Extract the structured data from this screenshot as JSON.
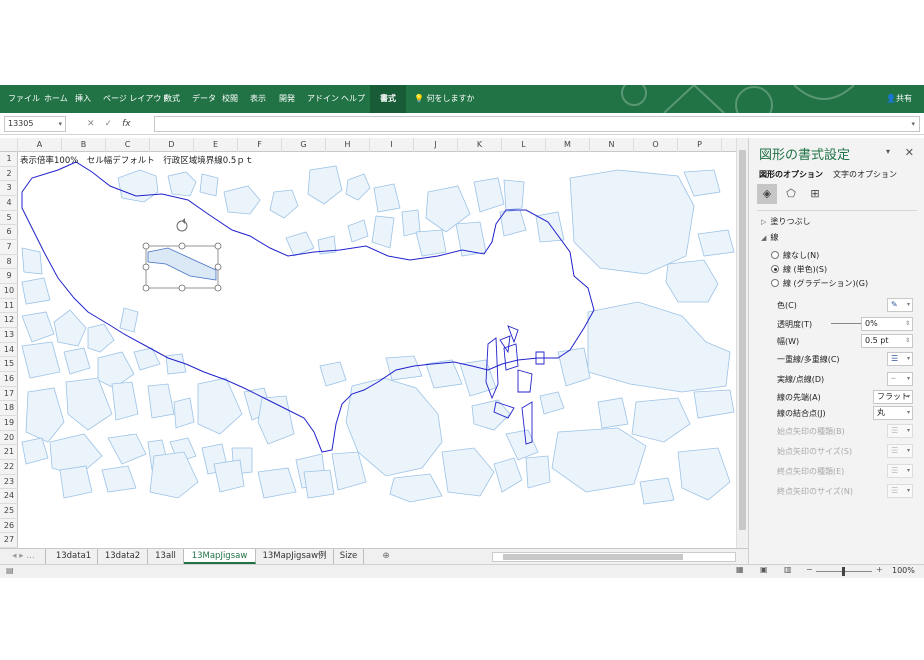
{
  "ribbon": {
    "tabs": [
      "ファイル",
      "ホーム",
      "挿入",
      "ページ レイアウト",
      "数式",
      "データ",
      "校閲",
      "表示",
      "開発",
      "アドイン",
      "ヘルプ",
      "書式"
    ],
    "active_tab": "書式",
    "tell_me": "何をしますか",
    "share": "共有"
  },
  "formula_bar": {
    "name_box": "13305",
    "cancel": "✕",
    "enter": "✓",
    "fx": "fx",
    "formula": ""
  },
  "columns": [
    "A",
    "B",
    "C",
    "D",
    "E",
    "F",
    "G",
    "H",
    "I",
    "J",
    "K",
    "L",
    "M",
    "N",
    "O",
    "P"
  ],
  "rows": [
    "1",
    "2",
    "3",
    "4",
    "5",
    "6",
    "7",
    "8",
    "9",
    "10",
    "11",
    "12",
    "13",
    "14",
    "15",
    "16",
    "17",
    "18",
    "19",
    "20",
    "21",
    "22",
    "23",
    "24",
    "25",
    "26",
    "27"
  ],
  "cell_note": "表示倍率100%　セル幅デフォルト　行政区域境界線0.5ｐｔ",
  "sheets": [
    "13data1",
    "13data2",
    "13all",
    "13MapJigsaw",
    "13MapJigsaw例",
    "Size"
  ],
  "active_sheet": "13MapJigsaw",
  "add_sheet": "⊕",
  "status": {
    "zoom": "100%"
  },
  "pane": {
    "title": "図形の書式設定",
    "tab_shape": "図形のオプション",
    "tab_text": "文字のオプション",
    "section_fill": "塗りつぶし",
    "section_line": "線",
    "radio_none": "線なし(N)",
    "radio_solid": "線 (単色)(S)",
    "radio_gradient": "線 (グラデーション)(G)",
    "color_label": "色(C)",
    "transparency_label": "透明度(T)",
    "transparency_value": "0%",
    "width_label": "幅(W)",
    "width_value": "0.5 pt",
    "compound_label": "一重線/多重線(C)",
    "dash_label": "実線/点線(D)",
    "cap_label": "線の先端(A)",
    "cap_value": "フラット",
    "join_label": "線の結合点(J)",
    "join_value": "丸",
    "begin_arrow_type": "始点矢印の種類(B)",
    "begin_arrow_size": "始点矢印のサイズ(S)",
    "end_arrow_type": "終点矢印の種類(E)",
    "end_arrow_size": "終点矢印のサイズ(N)"
  },
  "colors": {
    "excel_green": "#217346",
    "piece_fill": "#ebf3fb",
    "piece_stroke": "#9dc3e6",
    "boundary": "#2222cc"
  }
}
